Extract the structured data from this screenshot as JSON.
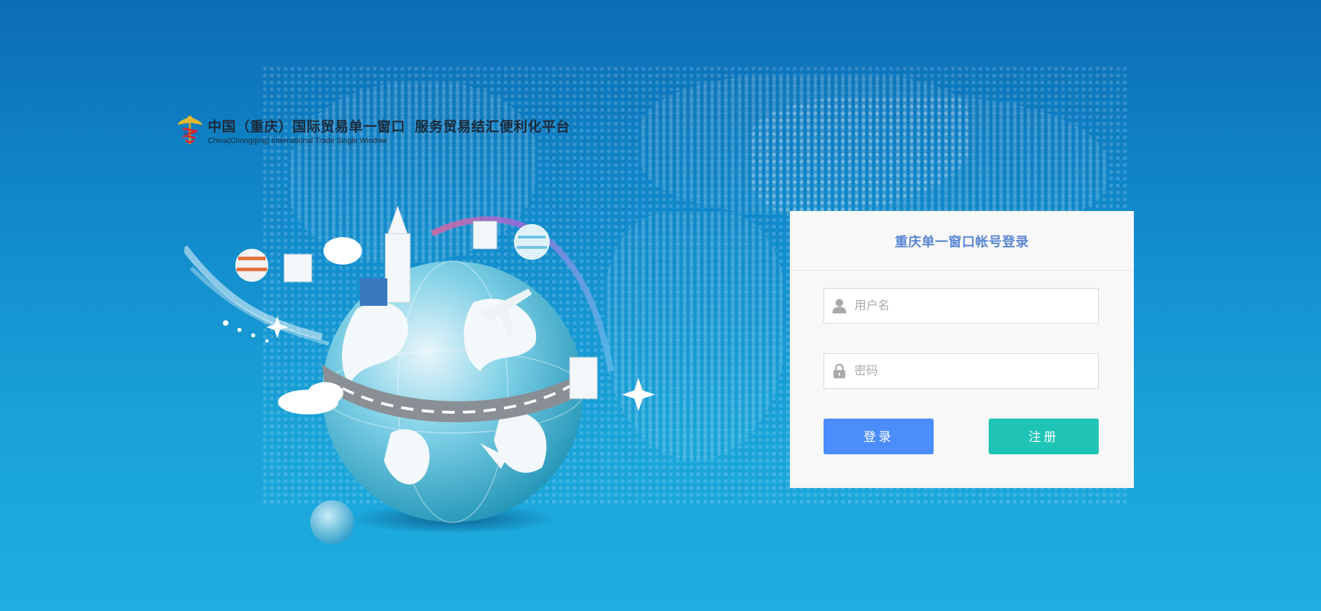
{
  "header": {
    "title_part1": "中国（重庆）国际贸易单一窗口",
    "title_part2": "服务贸易结汇便利化平台",
    "subtitle": "China(Chongqing) International Trade Single Window"
  },
  "login": {
    "title": "重庆单一窗口帐号登录",
    "username": {
      "placeholder": "用户名",
      "value": "",
      "icon": "user-icon"
    },
    "password": {
      "placeholder": "密码",
      "value": "",
      "icon": "lock-icon"
    },
    "login_label": "登录",
    "register_label": "注册"
  },
  "colors": {
    "background_top": "#0c6db5",
    "background_bottom": "#1eaee0",
    "card_title": "#5b86d4",
    "login_button": "#4b8dfb",
    "register_button": "#1fc4b6"
  }
}
